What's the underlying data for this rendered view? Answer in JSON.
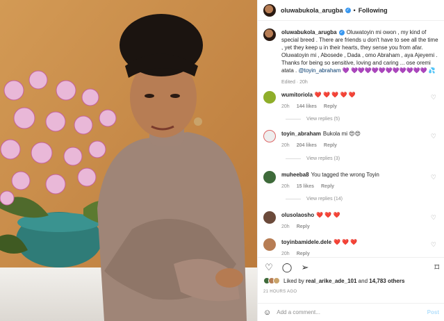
{
  "header": {
    "username": "oluwabukola_arugba",
    "verified_glyph": "✓",
    "separator": "•",
    "follow_status": "Following"
  },
  "caption": {
    "username": "oluwabukola_arugba",
    "text": "Oluwatoyin mi owon , my kind of special breed . There are friends u don't have to see all the time , yet they keep u in their hearts, they sense you from afar. Oluwatoyin mi , Abosede , Dada , omo Abraham , aya Ajeyemi . Thanks for being so sensitive, loving and caring ... ose oremi atata .",
    "mention": "@toyin_abraham",
    "emoji": "💜 💜💜💜💜💜💜💜💜💜💜💜 💦",
    "meta": "Edited · 20h"
  },
  "comments": [
    {
      "user": "wumitoriola",
      "text": "❤️ ❤️ ❤️ ❤️ ❤️",
      "time": "20h",
      "likes": "144 likes",
      "reply": "Reply",
      "view_replies": "View replies (5)"
    },
    {
      "user": "toyin_abraham",
      "text": "Bukola mi 😍😍",
      "time": "20h",
      "likes": "204 likes",
      "reply": "Reply",
      "view_replies": "View replies (3)"
    },
    {
      "user": "muheeba8",
      "text": "You tagged the wrong Toyin",
      "time": "20h",
      "likes": "15 likes",
      "reply": "Reply",
      "view_replies": "View replies (14)"
    },
    {
      "user": "olusolaosho",
      "text": "❤️ ❤️ ❤️",
      "time": "20h",
      "likes": "",
      "reply": "Reply",
      "view_replies": ""
    },
    {
      "user": "toyinbamidele.dele",
      "text": "❤️ ❤️ ❤️",
      "time": "20h",
      "likes": "",
      "reply": "Reply",
      "view_replies": ""
    }
  ],
  "icons": {
    "like": "heart-icon",
    "comment": "comment-icon",
    "share": "share-icon",
    "save": "bookmark-icon",
    "emoji": "emoji-icon"
  },
  "likes": {
    "prefix": "Liked by",
    "user": "real_arike_ade_101",
    "connector": "and",
    "others": "14,783 others"
  },
  "timestamp": "21 HOURS AGO",
  "add_comment": {
    "placeholder": "Add a comment...",
    "post": "Post"
  },
  "colors": {
    "verified": "#3897f0",
    "link": "#00376b",
    "post": "#b2dffc",
    "photo_bg": "#c98a46"
  }
}
